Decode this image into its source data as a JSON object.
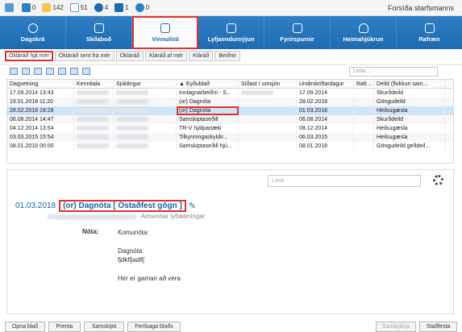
{
  "topbar": {
    "items": [
      {
        "icon": "calendar-icon",
        "value": ""
      },
      {
        "icon": "chart-icon",
        "value": "0"
      },
      {
        "icon": "document-icon",
        "value": "142"
      },
      {
        "icon": "mail-icon",
        "value": "51"
      },
      {
        "icon": "info-icon",
        "value": "4"
      },
      {
        "icon": "prescription-icon",
        "value": "1"
      },
      {
        "icon": "person-icon",
        "value": "0"
      }
    ],
    "user_role": "Forsíða starfsmanns"
  },
  "nav": {
    "items": [
      {
        "label": "Dagskrá",
        "icon": "clock-icon"
      },
      {
        "label": "Skilaboð",
        "icon": "envelope-icon"
      },
      {
        "label": "Vinnulisti",
        "icon": "clipboard-icon"
      },
      {
        "label": "Lyfjaendurnýjun",
        "icon": "pill-icon"
      },
      {
        "label": "Fyrirspurnir",
        "icon": "chat-icon"
      },
      {
        "label": "Heimahjúkrun",
        "icon": "nurse-icon"
      },
      {
        "label": "Rafræn",
        "icon": "device-icon"
      }
    ],
    "active_index": 2
  },
  "subtabs": [
    "Ókláráð hjá mér",
    "Ókláráð sent frá mér",
    "Ókláráð",
    "Kláráð af mér",
    "Kláráð",
    "Beiðnir"
  ],
  "toolbar": {
    "search_placeholder": "Leita ..."
  },
  "table": {
    "headers": [
      "Dagsetning",
      "Kennitala",
      "Sjúklingur",
      "Eyðublað",
      "Síðast í umsjón",
      "Undirskriftardagur",
      "Rafr...",
      "Deild (flokkun sam...",
      ""
    ],
    "rows": [
      {
        "date": "17.09.2014 13:43",
        "form": "Innlagnarbeiðni - S...",
        "signed": "17.09.2014",
        "dept": "Skurðdeild"
      },
      {
        "date": "19.01.2018 11:20",
        "form": "(or) Dagnóta",
        "signed": "28.02.2018",
        "dept": "Göngudeild"
      },
      {
        "date": "28.02.2018 18:28",
        "form": "(or) Dagnóta",
        "signed": "01.03.2018",
        "dept": "Heilsugæsla"
      },
      {
        "date": "06.08.2014 14:47",
        "form": "Samskiptaseðill",
        "signed": "06.08.2014",
        "dept": "Skurðdeild"
      },
      {
        "date": "04.12.2014 13:54",
        "form": "TR-V hjálpartæki",
        "signed": "08.12.2014",
        "dept": "Heilsugæsla"
      },
      {
        "date": "03.03.2015 15:54",
        "form": "Tilkynningaskyldir...",
        "signed": "06.03.2015",
        "dept": "Heilsugæsla"
      },
      {
        "date": "08.01.2018 00:00",
        "form": "Samskiptaseðill hjú...",
        "signed": "08.01.2018",
        "dept": "Göngudeild geðdeil..."
      }
    ],
    "selected_index": 2
  },
  "detail": {
    "search_placeholder": "Leita",
    "date": "01.03.2018",
    "title": "(or) Dagnóta [ Óstaðfest gögn ]",
    "subtitle": "Almennar lyflækningar",
    "note_label": "Nóta:",
    "note_lines": [
      "Komunóta:",
      "Dagnóta:",
      "fjdklfjadlfj´",
      "Hér er gaman að vera"
    ]
  },
  "buttons": {
    "open_sheet": "Opna blað",
    "print": "Prenta",
    "message": "Samskipti",
    "history": "Ferilsaga blaðs",
    "approve": "Sambykkja",
    "confirm": "Staðfesta"
  }
}
